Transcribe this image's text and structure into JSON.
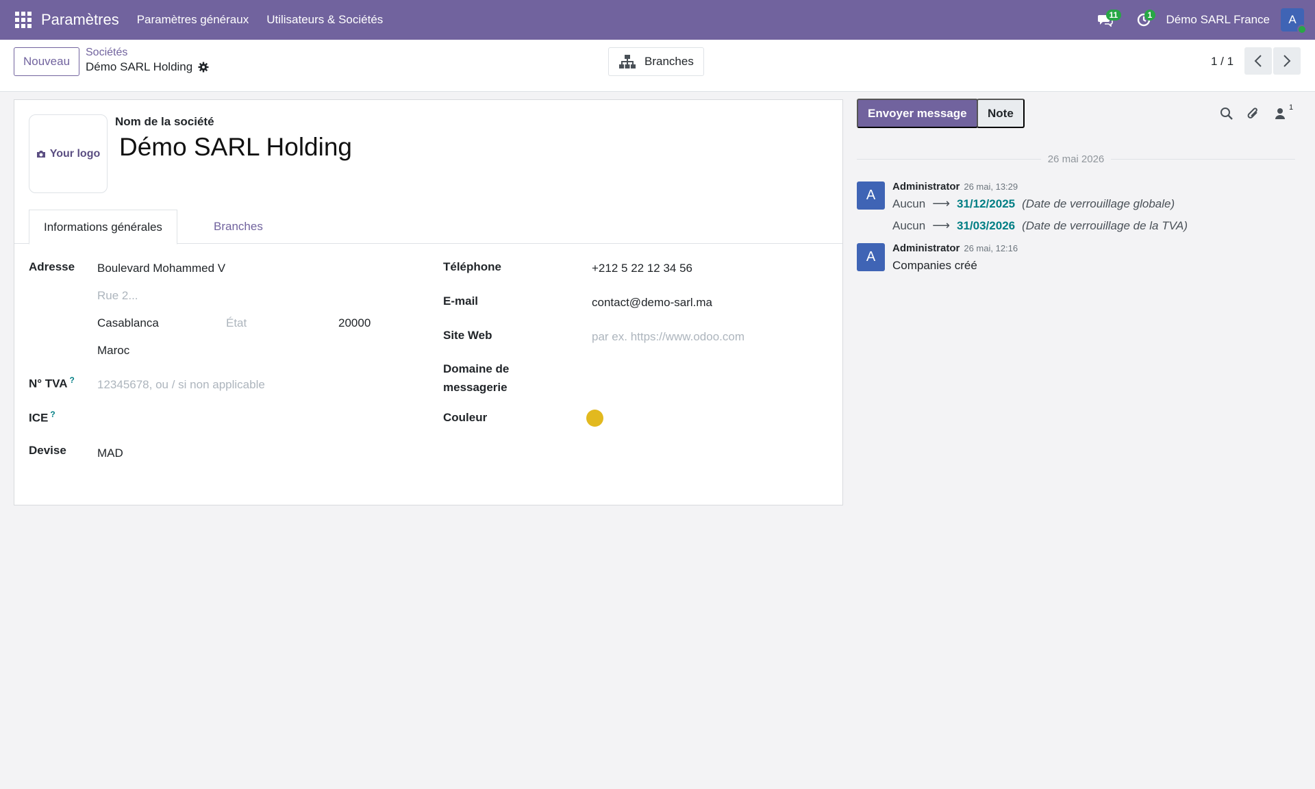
{
  "navbar": {
    "app_name": "Paramètres",
    "menu": [
      "Paramètres généraux",
      "Utilisateurs & Sociétés"
    ],
    "messages_badge": "11",
    "activities_badge": "1",
    "company": "Démo SARL France",
    "avatar_initial": "A"
  },
  "control_panel": {
    "new_label": "Nouveau",
    "breadcrumb_parent": "Sociétés",
    "breadcrumb_current": "Démo SARL Holding",
    "branches_button": "Branches",
    "pager": "1 / 1"
  },
  "form": {
    "logo_text": "Your logo",
    "company_name_label": "Nom de la société",
    "company_name": "Démo SARL Holding",
    "tabs": [
      "Informations générales",
      "Branches"
    ],
    "left": {
      "address_label": "Adresse",
      "street": "Boulevard Mohammed V",
      "street2_placeholder": "Rue 2...",
      "city": "Casablanca",
      "state_placeholder": "État",
      "zip": "20000",
      "country": "Maroc",
      "vat_label": "N° TVA",
      "vat_placeholder": "12345678, ou / si non applicable",
      "ice_label": "ICE",
      "currency_label": "Devise",
      "currency": "MAD",
      "help_mark": "?"
    },
    "right": {
      "phone_label": "Téléphone",
      "phone": "+212 5 22 12 34 56",
      "email_label": "E-mail",
      "email": "contact@demo-sarl.ma",
      "website_label": "Site Web",
      "website_placeholder": "par ex. https://www.odoo.com",
      "mail_domain_label_1": "Domaine de",
      "mail_domain_label_2": "messagerie",
      "color_label": "Couleur",
      "color_value": "#e2b91f"
    }
  },
  "chatter": {
    "send_message": "Envoyer message",
    "note": "Note",
    "followers_count": "1",
    "date_separator": "26 mai 2026",
    "messages": [
      {
        "avatar": "A",
        "author": "Administrator",
        "time": "26 mai, 13:29",
        "changes": [
          {
            "old": "Aucun",
            "new": "31/12/2025",
            "field": "(Date de verrouillage globale)"
          },
          {
            "old": "Aucun",
            "new": "31/03/2026",
            "field": "(Date de verrouillage de la TVA)"
          }
        ]
      },
      {
        "avatar": "A",
        "author": "Administrator",
        "time": "26 mai, 12:16",
        "body": "Companies créé"
      }
    ]
  },
  "colors": {
    "brand": "#71639e",
    "link_teal": "#017e84",
    "badge_green": "#28a745",
    "avatar_blue": "#3f64b5"
  }
}
